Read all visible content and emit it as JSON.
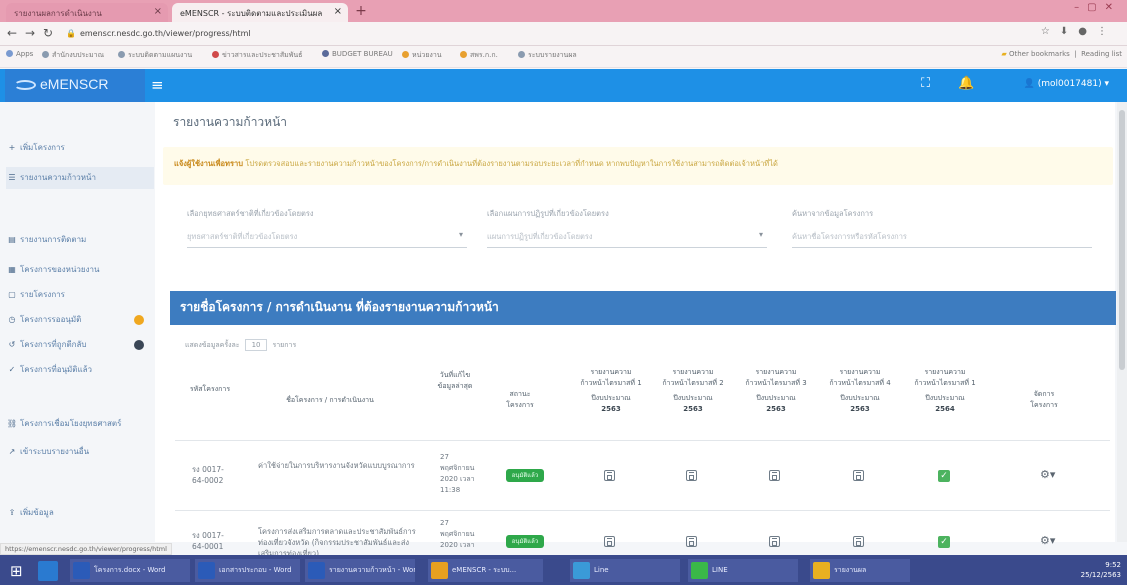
{
  "browser": {
    "tabs": [
      {
        "label": "รายงานผลการดำเนินงาน",
        "active": false
      },
      {
        "label": "eMENSCR - ระบบติดตามและประเมินผล",
        "active": true
      }
    ],
    "url": "emenscr.nesdc.go.th/viewer/progress/html",
    "bookmarks": [
      "Apps",
      "สำนักงบประมาณ",
      "ระบบติดตามแผนงาน",
      "ข่าวสารและประชาสัมพันธ์",
      "BUDGET BUREAU",
      "หน่วยงาน",
      "สพร.ก.ก.",
      "ระบบรายงานผล"
    ],
    "other_bookmarks": "Other bookmarks",
    "reading_list": "Reading list"
  },
  "app": {
    "logo": "eMENSCR",
    "user": "(mol0017481)"
  },
  "sidebar": {
    "items": [
      {
        "label": "เพิ่มโครงการ",
        "icon": "plus-icon",
        "active": false
      },
      {
        "label": "รายงานความก้าวหน้า",
        "icon": "list-icon",
        "active": true
      },
      {
        "label": "รายงานการติดตาม",
        "icon": "report-icon",
        "active": false
      },
      {
        "label": "โครงการของหน่วยงาน",
        "icon": "folder-icon",
        "active": false
      },
      {
        "label": "รายโครงการ",
        "icon": "doc-icon",
        "active": false
      },
      {
        "label": "โครงการรออนุมัติ",
        "icon": "clock-icon",
        "active": false
      },
      {
        "label": "โครงการที่ถูกตีกลับ",
        "icon": "return-icon",
        "active": false
      },
      {
        "label": "โครงการที่อนุมัติแล้ว",
        "icon": "check-icon",
        "active": false
      },
      {
        "label": "โครงการเชื่อมโยงยุทธศาสตร์",
        "icon": "link-icon",
        "active": false
      },
      {
        "label": "เข้าระบบรายงานอื่น",
        "icon": "chart-icon",
        "active": false
      },
      {
        "label": "เพิ่มข้อมูล",
        "icon": "upload-icon",
        "active": false
      }
    ]
  },
  "page": {
    "title": "รายงานความก้าวหน้า",
    "notice_bold": "แจ้งผู้ใช้งานเพื่อทราบ",
    "notice_text": " โปรดตรวจสอบและรายงานความก้าวหน้าของโครงการ/การดำเนินงานที่ต้องรายงานตามรอบระยะเวลาที่กำหนด หากพบปัญหาในการใช้งานสามารถติดต่อเจ้าหน้าที่ได้",
    "filters": [
      {
        "label": "เลือกยุทธศาสตร์ชาติที่เกี่ยวข้องโดยตรง",
        "placeholder": "ยุทธศาสตร์ชาติที่เกี่ยวข้องโดยตรง"
      },
      {
        "label": "เลือกแผนการปฏิรูปที่เกี่ยวข้องโดยตรง",
        "placeholder": "แผนการปฏิรูปที่เกี่ยวข้องโดยตรง"
      },
      {
        "label": "ค้นหาจากข้อมูลโครงการ",
        "placeholder": "ค้นหาชื่อโครงการหรือรหัสโครงการ"
      }
    ],
    "panel_title": "รายชื่อโครงการ / การดำเนินงาน ที่ต้องรายงานความก้าวหน้า",
    "show_prefix": "แสดงข้อมูลครั้งละ",
    "show_value": "10",
    "show_suffix": "รายการ"
  },
  "table": {
    "headers": {
      "code": "รหัสโครงการ",
      "name": "ชื่อโครงการ / การดำเนินงาน",
      "date": "วันที่แก้ไขข้อมูลล่าสุด",
      "status": "สถานะโครงการ",
      "q1": [
        "รายงานความก้าวหน้าไตรมาสที่ 1",
        "ปีงบประมาณ",
        "2563"
      ],
      "q2": [
        "รายงานความก้าวหน้าไตรมาสที่ 2",
        "ปีงบประมาณ",
        "2563"
      ],
      "q3": [
        "รายงานความก้าวหน้าไตรมาสที่ 3",
        "ปีงบประมาณ",
        "2563"
      ],
      "q4": [
        "รายงานความก้าวหน้าไตรมาสที่ 4",
        "ปีงบประมาณ",
        "2563"
      ],
      "q5": [
        "รายงานความก้าวหน้าไตรมาสที่ 1",
        "ปีงบประมาณ",
        "2564"
      ],
      "manage": "จัดการโครงการ"
    },
    "rows": [
      {
        "code": "รง 0017-64-0002",
        "name": "ค่าใช้จ่ายในการบริหารงานจังหวัดแบบบูรณาการ",
        "date": "27 พฤศจิกายน 2020 เวลา 11:38",
        "status": "อนุมัติแล้ว"
      },
      {
        "code": "รง 0017-64-0001",
        "name": "โครงการส่งเสริมการตลาดและประชาสัมพันธ์การท่องเที่ยวจังหวัด (กิจกรรมประชาสัมพันธ์และส่งเสริมการท่องเที่ยว)",
        "date": "27 พฤศจิกายน 2020 เวลา",
        "status": "อนุมัติแล้ว"
      }
    ]
  },
  "statusbar": "https://emenscr.nesdc.go.th/viewer/progress/html",
  "taskbar": {
    "items": [
      "โครงการ.docx - Word",
      "เอกสารประกอบ - Word",
      "รายงานความก้าวหน้า - Word",
      "eMENSCR - ระบบ...",
      "Line",
      "LINE",
      "รายงานผล"
    ],
    "time": "9:52",
    "date": "25/12/2563"
  },
  "colors": {
    "header": "#1e90e6",
    "panel": "#3d7cc0",
    "badge": "#2ea84a"
  }
}
